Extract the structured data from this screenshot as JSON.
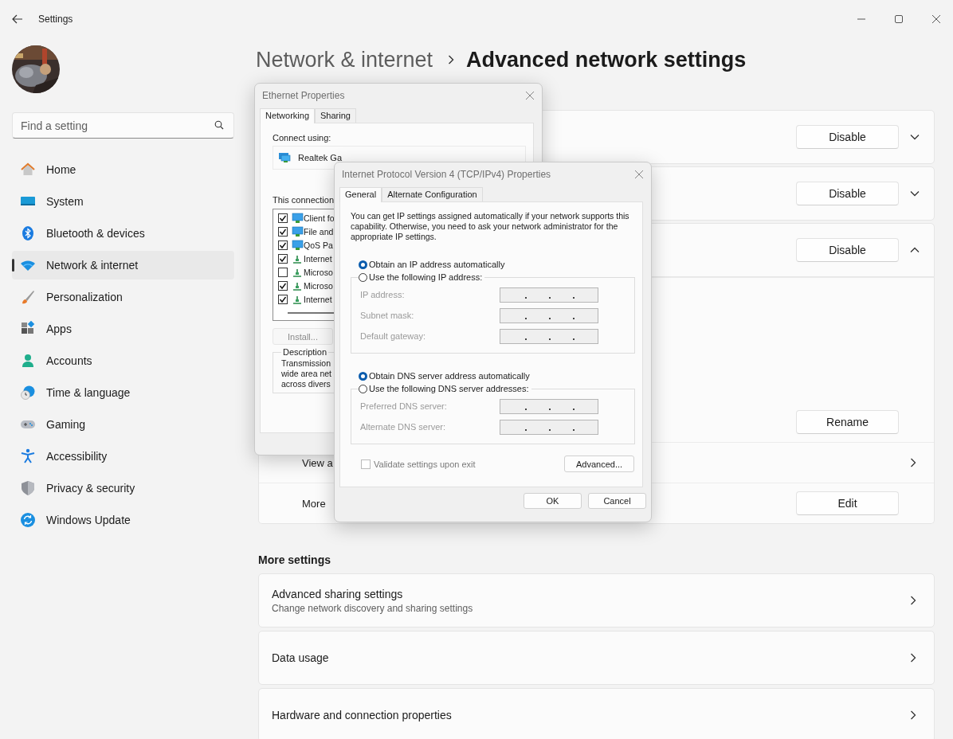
{
  "window": {
    "title": "Settings"
  },
  "search": {
    "placeholder": "Find a setting"
  },
  "nav": [
    {
      "label": "Home",
      "selected": false
    },
    {
      "label": "System",
      "selected": false
    },
    {
      "label": "Bluetooth & devices",
      "selected": false
    },
    {
      "label": "Network & internet",
      "selected": true
    },
    {
      "label": "Personalization",
      "selected": false
    },
    {
      "label": "Apps",
      "selected": false
    },
    {
      "label": "Accounts",
      "selected": false
    },
    {
      "label": "Time & language",
      "selected": false
    },
    {
      "label": "Gaming",
      "selected": false
    },
    {
      "label": "Accessibility",
      "selected": false
    },
    {
      "label": "Privacy & security",
      "selected": false
    },
    {
      "label": "Windows Update",
      "selected": false
    }
  ],
  "breadcrumb": {
    "parent": "Network & internet",
    "current": "Advanced network settings"
  },
  "adapters": [
    {
      "button": "Disable",
      "expanded": false
    },
    {
      "button": "Disable",
      "expanded": false
    },
    {
      "button": "Disable",
      "expanded": true
    }
  ],
  "adapter_details": [
    {
      "kind": "button",
      "button": "Rename"
    },
    {
      "kind": "link",
      "label": "View a"
    },
    {
      "kind": "button",
      "label": "More",
      "button": "Edit"
    }
  ],
  "more_settings": {
    "heading": "More settings",
    "items": [
      {
        "title": "Advanced sharing settings",
        "subtitle": "Change network discovery and sharing settings"
      },
      {
        "title": "Data usage"
      },
      {
        "title": "Hardware and connection properties"
      }
    ]
  },
  "ethernet_dialog": {
    "title": "Ethernet Properties",
    "tabs": [
      {
        "label": "Networking",
        "selected": true
      },
      {
        "label": "Sharing",
        "selected": false
      }
    ],
    "connect_using": "Connect using:",
    "adapter": "Realtek Ga",
    "items_label": "This connection",
    "items": [
      {
        "label": "Client fo",
        "checked": true,
        "kind": "client"
      },
      {
        "label": "File and",
        "checked": true,
        "kind": "client"
      },
      {
        "label": "QoS Pa",
        "checked": true,
        "kind": "client"
      },
      {
        "label": "Internet",
        "checked": true,
        "kind": "protocol"
      },
      {
        "label": "Microso",
        "checked": false,
        "kind": "protocol"
      },
      {
        "label": "Microso",
        "checked": true,
        "kind": "protocol"
      },
      {
        "label": "Internet",
        "checked": true,
        "kind": "protocol"
      }
    ],
    "install_button": "Install...",
    "description_label": "Description",
    "description": "Transmission\nwide area net\nacross divers"
  },
  "ipv4_dialog": {
    "title": "Internet Protocol Version 4 (TCP/IPv4) Properties",
    "tabs": [
      {
        "label": "General",
        "selected": true
      },
      {
        "label": "Alternate Configuration",
        "selected": false
      }
    ],
    "intro": "You can get IP settings assigned automatically if your network supports this capability. Otherwise, you need to ask your network administrator for the appropriate IP settings.",
    "ip_options": [
      {
        "label": "Obtain an IP address automatically",
        "selected": true
      },
      {
        "label": "Use the following IP address:",
        "selected": false
      }
    ],
    "ip_fields": [
      {
        "label": "IP address:"
      },
      {
        "label": "Subnet mask:"
      },
      {
        "label": "Default gateway:"
      }
    ],
    "dns_options": [
      {
        "label": "Obtain DNS server address automatically",
        "selected": true
      },
      {
        "label": "Use the following DNS server addresses:",
        "selected": false
      }
    ],
    "dns_fields": [
      {
        "label": "Preferred DNS server:"
      },
      {
        "label": "Alternate DNS server:"
      }
    ],
    "validate": {
      "label": "Validate settings upon exit",
      "checked": false
    },
    "advanced_button": "Advanced...",
    "ok_button": "OK",
    "cancel_button": "Cancel"
  }
}
